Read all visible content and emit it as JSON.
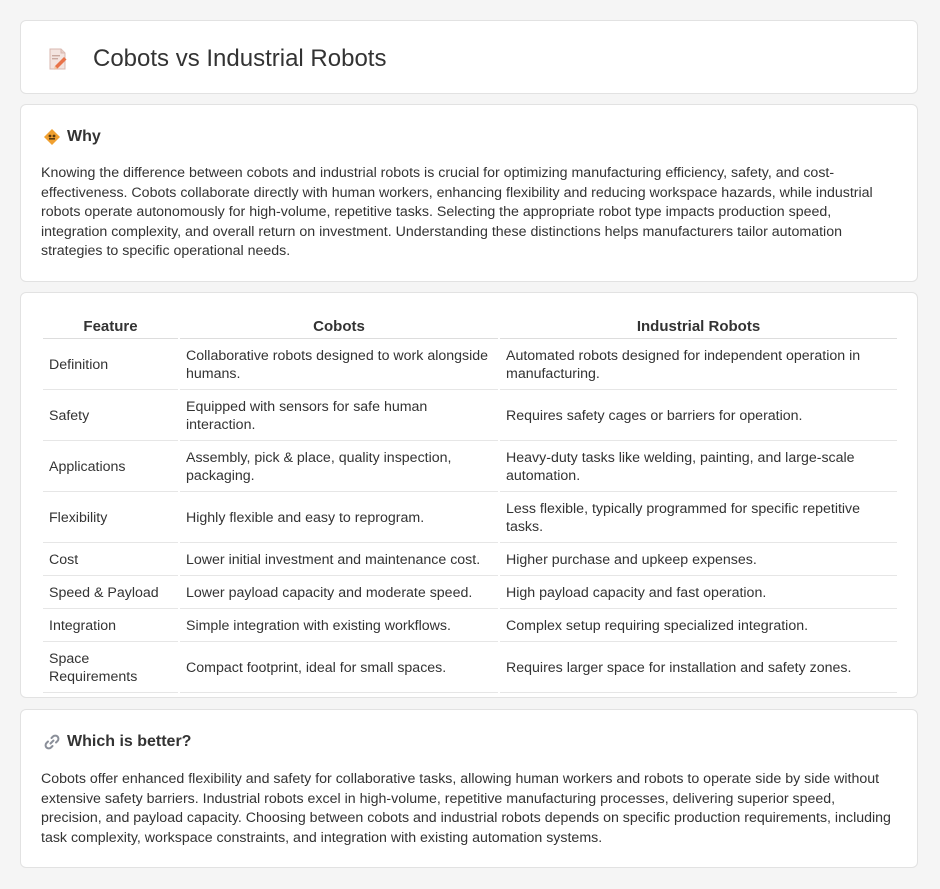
{
  "page": {
    "title": "Cobots vs Industrial Robots",
    "icon": "document-pencil-icon"
  },
  "why": {
    "title": "Why",
    "icon": "diamond-sign-icon",
    "text": "Knowing the difference between cobots and industrial robots is crucial for optimizing manufacturing efficiency, safety, and cost-effectiveness. Cobots collaborate directly with human workers, enhancing flexibility and reducing workspace hazards, while industrial robots operate autonomously for high-volume, repetitive tasks. Selecting the appropriate robot type impacts production speed, integration complexity, and overall return on investment. Understanding these distinctions helps manufacturers tailor automation strategies to specific operational needs."
  },
  "table": {
    "headers": [
      "Feature",
      "Cobots",
      "Industrial Robots"
    ],
    "rows": [
      [
        "Definition",
        "Collaborative robots designed to work alongside humans.",
        "Automated robots designed for independent operation in manufacturing."
      ],
      [
        "Safety",
        "Equipped with sensors for safe human interaction.",
        "Requires safety cages or barriers for operation."
      ],
      [
        "Applications",
        "Assembly, pick & place, quality inspection, packaging.",
        "Heavy-duty tasks like welding, painting, and large-scale automation."
      ],
      [
        "Flexibility",
        "Highly flexible and easy to reprogram.",
        "Less flexible, typically programmed for specific repetitive tasks."
      ],
      [
        "Cost",
        "Lower initial investment and maintenance cost.",
        "Higher purchase and upkeep expenses."
      ],
      [
        "Speed & Payload",
        "Lower payload capacity and moderate speed.",
        "High payload capacity and fast operation."
      ],
      [
        "Integration",
        "Simple integration with existing workflows.",
        "Complex setup requiring specialized integration."
      ],
      [
        "Space Requirements",
        "Compact footprint, ideal for small spaces.",
        "Requires larger space for installation and safety zones."
      ]
    ]
  },
  "better": {
    "title": "Which is better?",
    "icon": "link-icon",
    "text": "Cobots offer enhanced flexibility and safety for collaborative tasks, allowing human workers and robots to operate side by side without extensive safety barriers. Industrial robots excel in high-volume, repetitive manufacturing processes, delivering superior speed, precision, and payload capacity. Choosing between cobots and industrial robots depends on specific production requirements, including task complexity, workspace constraints, and integration with existing automation systems."
  },
  "colors": {
    "background": "#f5f5f5",
    "card": "#ffffff",
    "border": "#e2e2e2",
    "text": "#333333",
    "icon_orange": "#f0a030",
    "icon_pencil": "#e8734a"
  }
}
